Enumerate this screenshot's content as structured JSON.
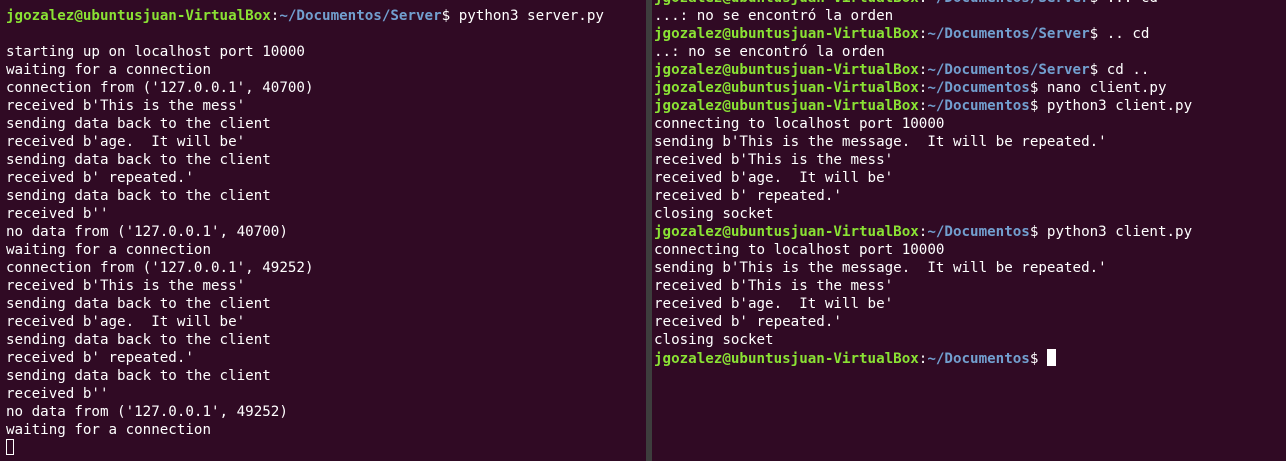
{
  "left_terminal": {
    "lines": [
      {
        "type": "prompt",
        "user": "jgozalez@ubuntusjuan-VirtualBox",
        "path": "~/Documentos/Server",
        "symbol": "$",
        "command": " python3 server.py"
      },
      {
        "type": "output",
        "text": ""
      },
      {
        "type": "output",
        "text": "starting up on localhost port 10000"
      },
      {
        "type": "output",
        "text": "waiting for a connection"
      },
      {
        "type": "output",
        "text": "connection from ('127.0.0.1', 40700)"
      },
      {
        "type": "output",
        "text": "received b'This is the mess'"
      },
      {
        "type": "output",
        "text": "sending data back to the client"
      },
      {
        "type": "output",
        "text": "received b'age.  It will be'"
      },
      {
        "type": "output",
        "text": "sending data back to the client"
      },
      {
        "type": "output",
        "text": "received b' repeated.'"
      },
      {
        "type": "output",
        "text": "sending data back to the client"
      },
      {
        "type": "output",
        "text": "received b''"
      },
      {
        "type": "output",
        "text": "no data from ('127.0.0.1', 40700)"
      },
      {
        "type": "output",
        "text": "waiting for a connection"
      },
      {
        "type": "output",
        "text": "connection from ('127.0.0.1', 49252)"
      },
      {
        "type": "output",
        "text": "received b'This is the mess'"
      },
      {
        "type": "output",
        "text": "sending data back to the client"
      },
      {
        "type": "output",
        "text": "received b'age.  It will be'"
      },
      {
        "type": "output",
        "text": "sending data back to the client"
      },
      {
        "type": "output",
        "text": "received b' repeated.'"
      },
      {
        "type": "output",
        "text": "sending data back to the client"
      },
      {
        "type": "output",
        "text": "received b''"
      },
      {
        "type": "output",
        "text": "no data from ('127.0.0.1', 49252)"
      },
      {
        "type": "output",
        "text": "waiting for a connection"
      },
      {
        "type": "cursor-outline"
      }
    ]
  },
  "right_terminal": {
    "lines": [
      {
        "type": "prompt",
        "user": "jgozalez@ubuntusjuan-VirtualBox",
        "path": "~/Documentos/Server",
        "symbol": "$",
        "command": " ... cd"
      },
      {
        "type": "output",
        "text": "...: no se encontró la orden"
      },
      {
        "type": "prompt",
        "user": "jgozalez@ubuntusjuan-VirtualBox",
        "path": "~/Documentos/Server",
        "symbol": "$",
        "command": " .. cd"
      },
      {
        "type": "output",
        "text": "..: no se encontró la orden"
      },
      {
        "type": "prompt",
        "user": "jgozalez@ubuntusjuan-VirtualBox",
        "path": "~/Documentos/Server",
        "symbol": "$",
        "command": " cd .."
      },
      {
        "type": "prompt",
        "user": "jgozalez@ubuntusjuan-VirtualBox",
        "path": "~/Documentos",
        "symbol": "$",
        "command": " nano client.py"
      },
      {
        "type": "prompt",
        "user": "jgozalez@ubuntusjuan-VirtualBox",
        "path": "~/Documentos",
        "symbol": "$",
        "command": " python3 client.py"
      },
      {
        "type": "output",
        "text": "connecting to localhost port 10000"
      },
      {
        "type": "output",
        "text": "sending b'This is the message.  It will be repeated.'"
      },
      {
        "type": "output",
        "text": "received b'This is the mess'"
      },
      {
        "type": "output",
        "text": "received b'age.  It will be'"
      },
      {
        "type": "output",
        "text": "received b' repeated.'"
      },
      {
        "type": "output",
        "text": "closing socket"
      },
      {
        "type": "prompt",
        "user": "jgozalez@ubuntusjuan-VirtualBox",
        "path": "~/Documentos",
        "symbol": "$",
        "command": " python3 client.py"
      },
      {
        "type": "output",
        "text": "connecting to localhost port 10000"
      },
      {
        "type": "output",
        "text": "sending b'This is the message.  It will be repeated.'"
      },
      {
        "type": "output",
        "text": "received b'This is the mess'"
      },
      {
        "type": "output",
        "text": "received b'age.  It will be'"
      },
      {
        "type": "output",
        "text": "received b' repeated.'"
      },
      {
        "type": "output",
        "text": "closing socket"
      },
      {
        "type": "prompt-cursor",
        "user": "jgozalez@ubuntusjuan-VirtualBox",
        "path": "~/Documentos",
        "symbol": "$",
        "command": " "
      }
    ]
  },
  "colors": {
    "background": "#300a24",
    "prompt_user": "#8ae234",
    "prompt_path": "#729fcf",
    "text": "#ffffff",
    "divider": "#3d3d3d"
  }
}
